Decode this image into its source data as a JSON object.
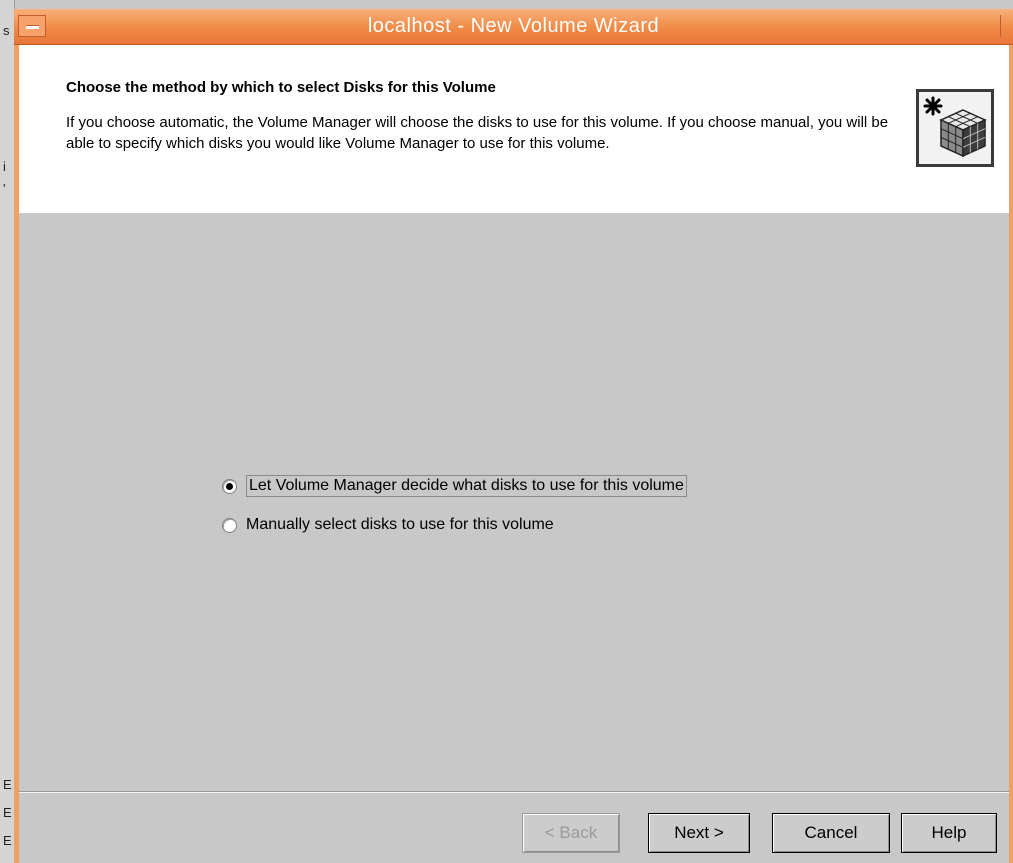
{
  "window": {
    "title": "localhost - New Volume Wizard"
  },
  "header": {
    "title": "Choose the method by which to select Disks for this Volume",
    "description": "If you choose automatic, the Volume Manager will choose the disks to use for this volume. If you choose manual, you will be able to specify which disks you would like Volume Manager to use for this volume."
  },
  "options": [
    {
      "label": "Let Volume Manager decide what disks to use for this volume",
      "mnemonic": "u",
      "selected": true
    },
    {
      "label": "Manually select disks to use for this volume",
      "mnemonic": "M",
      "selected": false
    }
  ],
  "buttons": {
    "back": {
      "label": "< Back",
      "enabled": false
    },
    "next": {
      "label": "Next >",
      "enabled": true
    },
    "cancel": {
      "label": "Cancel",
      "enabled": true
    },
    "help": {
      "label": "Help",
      "enabled": true
    }
  },
  "background_window": {
    "glyphs": [
      "s",
      "i",
      "'",
      "E",
      "E",
      "E"
    ]
  },
  "colors": {
    "titlebar": "#f08a46",
    "frame": "#f0a060",
    "panel": "#c8c8c8",
    "header_bg": "#ffffff"
  },
  "icons": {
    "wizard": "cube-volume-icon",
    "window_menu": "window-menu-icon"
  }
}
